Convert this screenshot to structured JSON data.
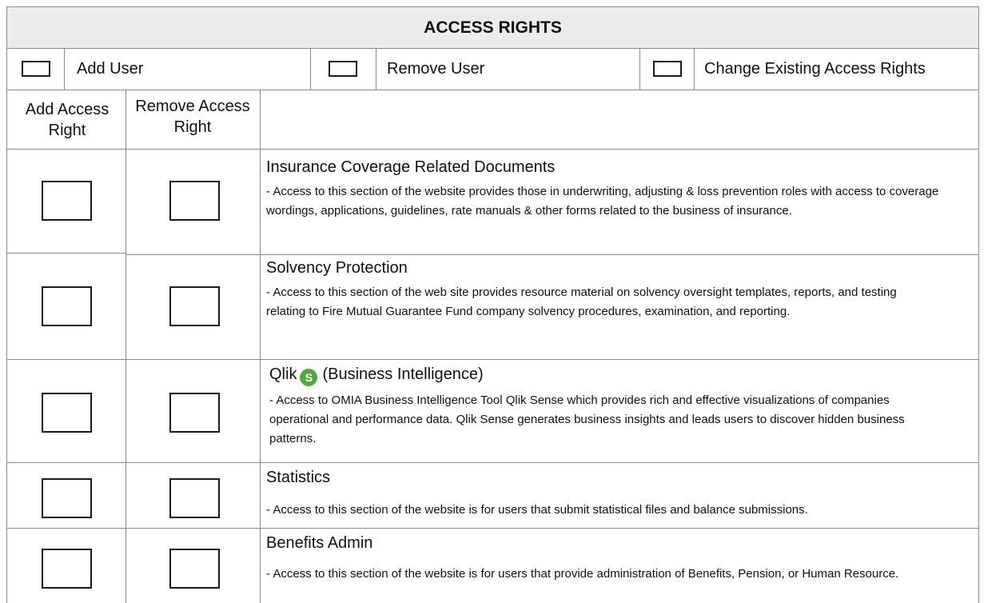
{
  "header": {
    "title": "ACCESS RIGHTS"
  },
  "user_options": [
    {
      "label": "Add User"
    },
    {
      "label": "Remove User"
    },
    {
      "label": "Change Existing Access Rights"
    }
  ],
  "columns": {
    "add": "Add Access Right",
    "remove": "Remove Access Right"
  },
  "sections": [
    {
      "title": "Insurance Coverage Related Documents",
      "description": "- Access to this section of the website provides those in underwriting, adjusting & loss prevention roles with access to coverage wordings, applications, guidelines, rate manuals & other forms related to the business of insurance."
    },
    {
      "title": "Solvency Protection",
      "description": "- Access to this section of the web site provides resource material on solvency oversight templates, reports, and testing relating to Fire Mutual Guarantee Fund company solvency procedures, examination, and reporting."
    },
    {
      "title_prefix": "Qlik",
      "title_suffix": "(Business Intelligence)",
      "icon": "qlik-sense-icon",
      "icon_glyph": "S",
      "icon_color": "#53a93f",
      "description": "- Access to OMIA Business Intelligence Tool Qlik Sense which provides rich and effective visualizations of companies operational and performance data. Qlik Sense generates business insights and leads users to discover hidden business patterns."
    },
    {
      "title": "Statistics",
      "description": "- Access to this section of the website is for users that submit statistical files and balance submissions."
    },
    {
      "title": "Benefits Admin",
      "description": "- Access to this section of the website is for users that provide administration of Benefits, Pension, or Human Resource."
    }
  ]
}
